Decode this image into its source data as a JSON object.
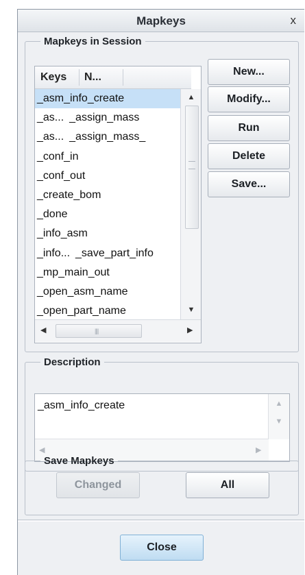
{
  "dialog": {
    "title": "Mapkeys",
    "close_glyph": "x"
  },
  "session": {
    "legend": "Mapkeys in Session",
    "columns": [
      "Keys",
      "N..."
    ],
    "rows": [
      {
        "key": "_asm_info_create",
        "name": ""
      },
      {
        "key": "_as...",
        "name": "_assign_mass"
      },
      {
        "key": "_as...",
        "name": "_assign_mass_"
      },
      {
        "key": "_conf_in",
        "name": ""
      },
      {
        "key": "_conf_out",
        "name": ""
      },
      {
        "key": "_create_bom",
        "name": ""
      },
      {
        "key": "_done",
        "name": ""
      },
      {
        "key": "_info_asm",
        "name": ""
      },
      {
        "key": "_info...",
        "name": "_save_part_info"
      },
      {
        "key": "_mp_main_out",
        "name": ""
      },
      {
        "key": "_open_asm_name",
        "name": ""
      },
      {
        "key": "_open_part_name",
        "name": ""
      }
    ],
    "selected_index": 0,
    "buttons": {
      "new": "New...",
      "modify": "Modify...",
      "run": "Run",
      "delete": "Delete",
      "save": "Save..."
    }
  },
  "description": {
    "legend": "Description",
    "text": "_asm_info_create"
  },
  "save_mapkeys": {
    "legend": "Save Mapkeys",
    "changed": "Changed",
    "all": "All"
  },
  "footer": {
    "close": "Close"
  },
  "colors": {
    "selection": "#c6e0f7",
    "primary_button": "#bfdcf2",
    "dialog_bg": "#eef0f3"
  },
  "icons": {
    "scroll_up": "up-arrow-icon",
    "scroll_down": "down-arrow-icon",
    "scroll_left": "left-arrow-icon",
    "scroll_right": "right-arrow-icon"
  }
}
